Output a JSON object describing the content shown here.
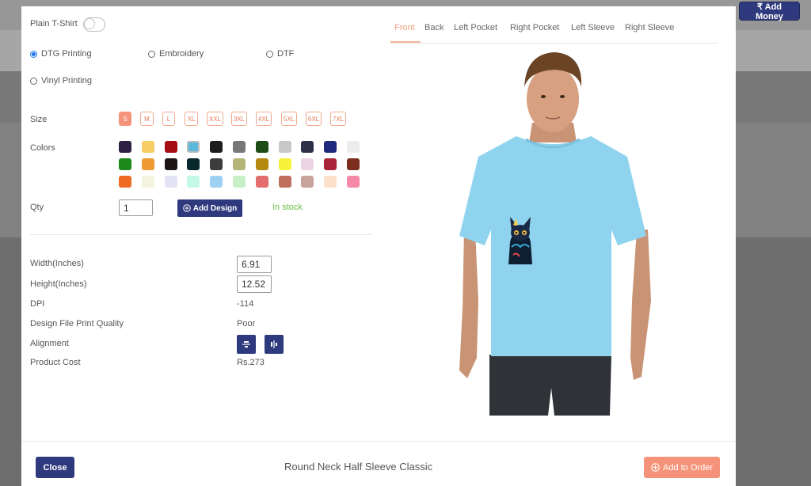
{
  "topbar": {
    "add_money_label": "₹ Add Money"
  },
  "plain_tshirt": {
    "label": "Plain T-Shirt",
    "enabled": false
  },
  "printing": {
    "options": [
      "DTG Printing",
      "Embroidery",
      "DTF",
      "Vinyl Printing"
    ],
    "selected": "DTG Printing"
  },
  "size": {
    "label": "Size",
    "options": [
      "S",
      "M",
      "L",
      "XL",
      "XXL",
      "3XL",
      "4XL",
      "5XL",
      "6XL",
      "7XL"
    ],
    "selected": "S"
  },
  "colors": {
    "label": "Colors",
    "swatches": [
      "#2e1f44",
      "#f6ce65",
      "#a50d14",
      "#5ab8db",
      "#1d1d1d",
      "#777777",
      "#1d4c14",
      "#c7c7c7",
      "#2c3049",
      "#1f2a7c",
      "#ececec",
      "#1b8a1b",
      "#ee9a32",
      "#1c1515",
      "#07282c",
      "#3d3d3d",
      "#b6b579",
      "#b4890f",
      "#f7f23c",
      "#ecd4e4",
      "#a92538",
      "#7c2e1e",
      "#ee6a25",
      "#f3f3df",
      "#e3e3f5",
      "#c3f8e6",
      "#9ed0f2",
      "#c7f0c6",
      "#e46d6d",
      "#bf6f5b",
      "#c8a39b",
      "#fde0cb",
      "#f789a8"
    ],
    "selected": "#5ab8db"
  },
  "qty": {
    "label": "Qty",
    "value": "1"
  },
  "add_design_label": "Add Design",
  "stock_label": "In stock",
  "details": {
    "width_label": "Width(Inches)",
    "width_value": "6.91",
    "height_label": "Height(Inches)",
    "height_value": "12.52",
    "dpi_label": "DPI",
    "dpi_value": "-114",
    "quality_label": "Design File Print Quality",
    "quality_value": "Poor",
    "alignment_label": "Alignment",
    "cost_label": "Product Cost",
    "cost_value": "Rs.273"
  },
  "tabs": [
    "Front",
    "Back",
    "Left Pocket",
    "Right Pocket",
    "Left Sleeve",
    "Right Sleeve"
  ],
  "active_tab": "Front",
  "preview": {
    "tshirt_color": "#8fd3ee"
  },
  "footer": {
    "close_label": "Close",
    "product_name": "Round Neck Half Sleeve Classic",
    "add_to_order_label": "Add to Order"
  }
}
